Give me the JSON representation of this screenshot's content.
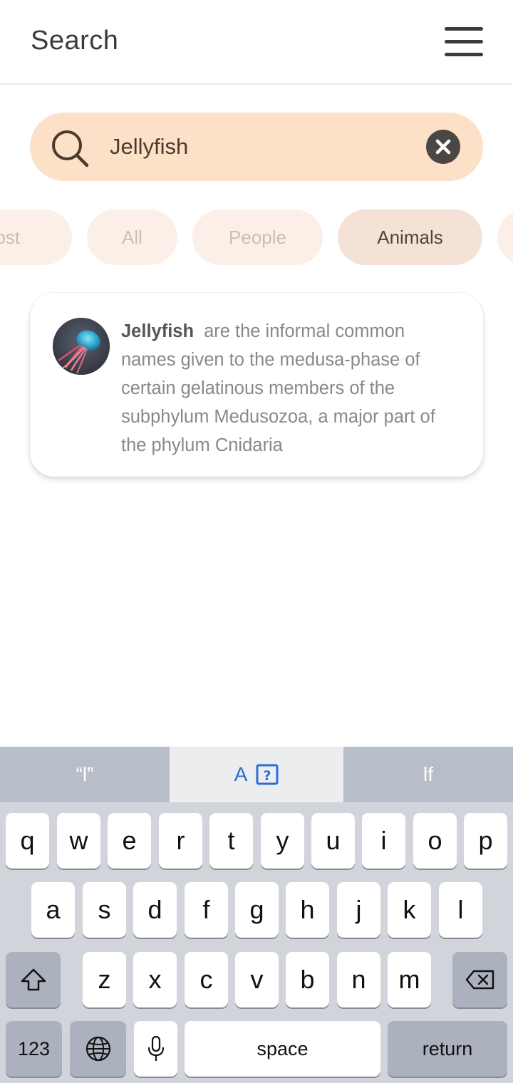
{
  "header": {
    "title": "Search",
    "menu_icon": "hamburger-menu-icon"
  },
  "search": {
    "value": "Jellyfish",
    "search_icon": "search-icon",
    "clear_icon": "close-icon"
  },
  "filters": [
    {
      "label": "Post",
      "active": false
    },
    {
      "label": "All",
      "active": false
    },
    {
      "label": "People",
      "active": false
    },
    {
      "label": "Animals",
      "active": true
    }
  ],
  "result": {
    "name": "Jellyfish",
    "description": "are the informal common names given to the medusa-phase of certain gelatinous members of the subphylum Medusozoa, a major part of the phylum Cnidaria",
    "avatar_icon": "jellyfish-photo"
  },
  "keyboard": {
    "suggestions": [
      "“l”",
      "A",
      "lf"
    ],
    "row1": [
      "q",
      "w",
      "e",
      "r",
      "t",
      "y",
      "u",
      "i",
      "o",
      "p"
    ],
    "row2": [
      "a",
      "s",
      "d",
      "f",
      "g",
      "h",
      "j",
      "k",
      "l"
    ],
    "row3": [
      "z",
      "x",
      "c",
      "v",
      "b",
      "n",
      "m"
    ],
    "numbers_label": "123",
    "space_label": "space",
    "return_label": "return"
  },
  "colors": {
    "accent": "#fde0c8",
    "chip_active": "#f4e2d6",
    "chip": "#fcefe8",
    "suggest_blue": "#2b6fd4"
  }
}
